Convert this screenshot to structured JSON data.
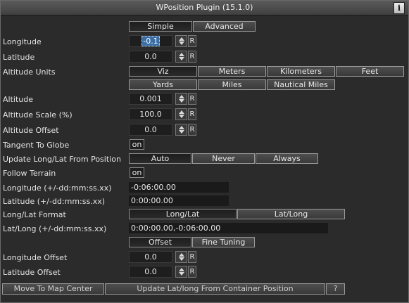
{
  "window": {
    "title": "WPosition Plugin (15.1.0)",
    "info_label": "i"
  },
  "mode_tabs": {
    "simple": "Simple",
    "advanced": "Advanced"
  },
  "longitude": {
    "label": "Longitude",
    "value": "-0.1",
    "reset": "R"
  },
  "latitude": {
    "label": "Latitude",
    "value": "0.0",
    "reset": "R"
  },
  "altitude_units": {
    "label": "Altitude Units",
    "options": [
      "Viz",
      "Meters",
      "Kilometers",
      "Feet",
      "Yards",
      "Miles",
      "Nautical Miles"
    ],
    "selected": "Viz"
  },
  "altitude": {
    "label": "Altitude",
    "value": "0.001",
    "reset": "R"
  },
  "altitude_scale": {
    "label": "Altitude Scale (%)",
    "value": "100.0",
    "reset": "R"
  },
  "altitude_offset": {
    "label": "Altitude Offset",
    "value": "0.0",
    "reset": "R"
  },
  "tangent_to_globe": {
    "label": "Tangent To Globe",
    "value": "on"
  },
  "update_longlat": {
    "label": "Update Long/Lat From Position",
    "options": [
      "Auto",
      "Never",
      "Always"
    ],
    "selected": "Auto"
  },
  "follow_terrain": {
    "label": "Follow Terrain",
    "value": "on"
  },
  "longitude_dms": {
    "label": "Longitude (+/-dd:mm:ss.xx)",
    "value": "-0:06:00.00"
  },
  "latitude_dms": {
    "label": "Latitude  (+/-dd:mm:ss.xx)",
    "value": "0:00:00.00"
  },
  "longlat_format": {
    "label": "Long/Lat Format",
    "options": [
      "Long/Lat",
      "Lat/Long"
    ],
    "selected": "Long/Lat"
  },
  "latlong_dms": {
    "label": "Lat/Long (+/-dd:mm:ss.xx)",
    "value": "0:00:00.00,-0:06:00.00"
  },
  "offset_tabs": {
    "offset": "Offset",
    "fine_tuning": "Fine Tuning"
  },
  "longitude_offset": {
    "label": "Longitude Offset",
    "value": "0.0",
    "reset": "R"
  },
  "latitude_offset": {
    "label": "Latitude Offset",
    "value": "0.0",
    "reset": "R"
  },
  "footer": {
    "move_to_map_center": "Move To Map Center",
    "update_from_container": "Update Lat/long From Container Position",
    "help": "?"
  }
}
